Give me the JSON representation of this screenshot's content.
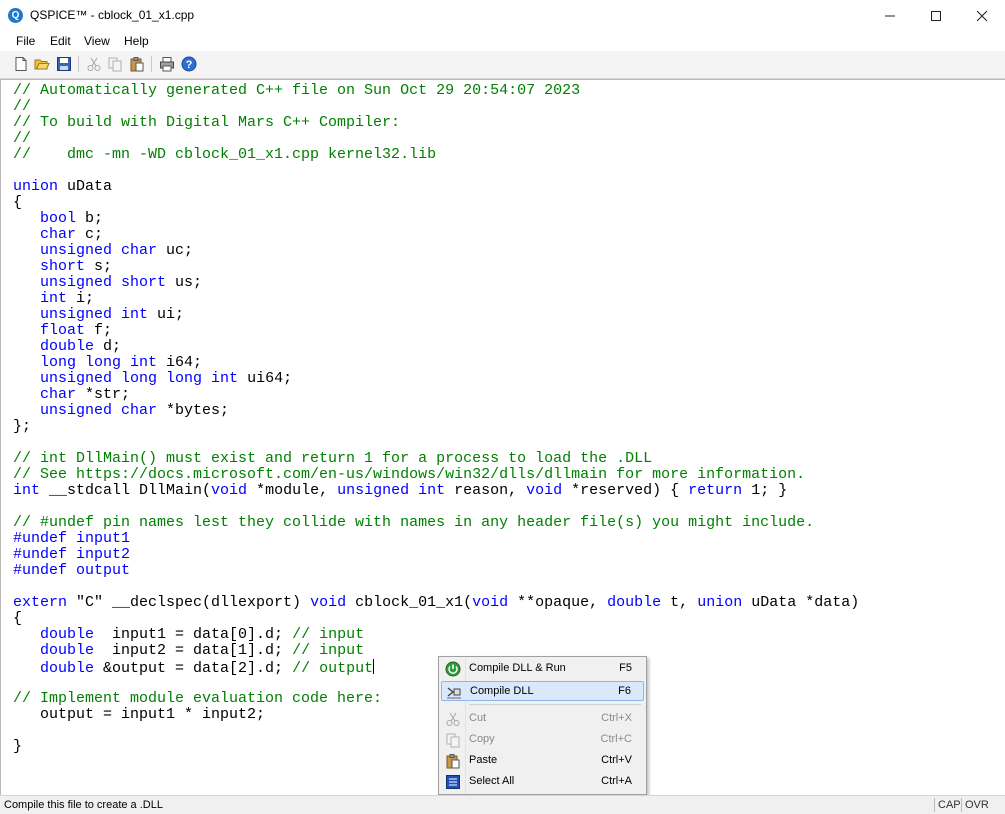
{
  "window": {
    "title": "QSPICE™ - cblock_01_x1.cpp",
    "app_icon_glyph": "Q",
    "icons": [
      "qspice-app-icon",
      "minimize-icon",
      "maximize-icon",
      "close-icon"
    ]
  },
  "menubar": {
    "items": [
      "File",
      "Edit",
      "View",
      "Help"
    ]
  },
  "toolbar": {
    "buttons": [
      {
        "name": "new-file-icon",
        "enabled": true
      },
      {
        "name": "open-folder-icon",
        "enabled": true
      },
      {
        "name": "save-icon",
        "enabled": true
      },
      {
        "name": "cut-icon",
        "enabled": false
      },
      {
        "name": "copy-icon",
        "enabled": false
      },
      {
        "name": "paste-icon",
        "enabled": true
      },
      {
        "name": "print-icon",
        "enabled": true
      },
      {
        "name": "help-icon",
        "enabled": true
      }
    ]
  },
  "editor": {
    "colors": {
      "comment": "#008000",
      "keyword": "#0000ff",
      "text": "#000000"
    },
    "lines": [
      [
        {
          "t": "// Automatically generated C++ file on Sun Oct 29 20:54:07 2023",
          "c": "cm"
        }
      ],
      [
        {
          "t": "//",
          "c": "cm"
        }
      ],
      [
        {
          "t": "// To build with Digital Mars C++ Compiler:",
          "c": "cm"
        }
      ],
      [
        {
          "t": "//",
          "c": "cm"
        }
      ],
      [
        {
          "t": "//    dmc -mn -WD cblock_01_x1.cpp kernel32.lib",
          "c": "cm"
        }
      ],
      [],
      [
        {
          "t": "union",
          "c": "kw"
        },
        {
          "t": " uData"
        }
      ],
      [
        {
          "t": "{"
        }
      ],
      [
        {
          "t": "   "
        },
        {
          "t": "bool",
          "c": "kw"
        },
        {
          "t": " b;"
        }
      ],
      [
        {
          "t": "   "
        },
        {
          "t": "char",
          "c": "kw"
        },
        {
          "t": " c;"
        }
      ],
      [
        {
          "t": "   "
        },
        {
          "t": "unsigned char",
          "c": "kw"
        },
        {
          "t": " uc;"
        }
      ],
      [
        {
          "t": "   "
        },
        {
          "t": "short",
          "c": "kw"
        },
        {
          "t": " s;"
        }
      ],
      [
        {
          "t": "   "
        },
        {
          "t": "unsigned short",
          "c": "kw"
        },
        {
          "t": " us;"
        }
      ],
      [
        {
          "t": "   "
        },
        {
          "t": "int",
          "c": "kw"
        },
        {
          "t": " i;"
        }
      ],
      [
        {
          "t": "   "
        },
        {
          "t": "unsigned int",
          "c": "kw"
        },
        {
          "t": " ui;"
        }
      ],
      [
        {
          "t": "   "
        },
        {
          "t": "float",
          "c": "kw"
        },
        {
          "t": " f;"
        }
      ],
      [
        {
          "t": "   "
        },
        {
          "t": "double",
          "c": "kw"
        },
        {
          "t": " d;"
        }
      ],
      [
        {
          "t": "   "
        },
        {
          "t": "long long int",
          "c": "kw"
        },
        {
          "t": " i64;"
        }
      ],
      [
        {
          "t": "   "
        },
        {
          "t": "unsigned long long int",
          "c": "kw"
        },
        {
          "t": " ui64;"
        }
      ],
      [
        {
          "t": "   "
        },
        {
          "t": "char",
          "c": "kw"
        },
        {
          "t": " *str;"
        }
      ],
      [
        {
          "t": "   "
        },
        {
          "t": "unsigned char",
          "c": "kw"
        },
        {
          "t": " *bytes;"
        }
      ],
      [
        {
          "t": "};"
        }
      ],
      [],
      [
        {
          "t": "// int DllMain() must exist and return 1 for a process to load the .DLL",
          "c": "cm"
        }
      ],
      [
        {
          "t": "// See https://docs.microsoft.com/en-us/windows/win32/dlls/dllmain for more information.",
          "c": "cm"
        }
      ],
      [
        {
          "t": "int",
          "c": "kw"
        },
        {
          "t": " __stdcall DllMain("
        },
        {
          "t": "void",
          "c": "kw"
        },
        {
          "t": " *module, "
        },
        {
          "t": "unsigned int",
          "c": "kw"
        },
        {
          "t": " reason, "
        },
        {
          "t": "void",
          "c": "kw"
        },
        {
          "t": " *reserved) { "
        },
        {
          "t": "return",
          "c": "kw"
        },
        {
          "t": " 1; }"
        }
      ],
      [],
      [
        {
          "t": "// #undef pin names lest they collide with names in any header file(s) you might include.",
          "c": "cm"
        }
      ],
      [
        {
          "t": "#undef",
          "c": "kw"
        },
        {
          "t": " "
        },
        {
          "t": "input1",
          "c": "kw"
        }
      ],
      [
        {
          "t": "#undef",
          "c": "kw"
        },
        {
          "t": " "
        },
        {
          "t": "input2",
          "c": "kw"
        }
      ],
      [
        {
          "t": "#undef",
          "c": "kw"
        },
        {
          "t": " "
        },
        {
          "t": "output",
          "c": "kw"
        }
      ],
      [],
      [
        {
          "t": "extern",
          "c": "kw"
        },
        {
          "t": " \"C\" __declspec(dllexport) "
        },
        {
          "t": "void",
          "c": "kw"
        },
        {
          "t": " cblock_01_x1("
        },
        {
          "t": "void",
          "c": "kw"
        },
        {
          "t": " **opaque, "
        },
        {
          "t": "double",
          "c": "kw"
        },
        {
          "t": " t, "
        },
        {
          "t": "union",
          "c": "kw"
        },
        {
          "t": " uData *data)"
        }
      ],
      [
        {
          "t": "{"
        }
      ],
      [
        {
          "t": "   "
        },
        {
          "t": "double",
          "c": "kw"
        },
        {
          "t": "  input1 = data[0].d; "
        },
        {
          "t": "// input",
          "c": "cm"
        }
      ],
      [
        {
          "t": "   "
        },
        {
          "t": "double",
          "c": "kw"
        },
        {
          "t": "  input2 = data[1].d; "
        },
        {
          "t": "// input",
          "c": "cm"
        }
      ],
      [
        {
          "t": "   "
        },
        {
          "t": "double",
          "c": "kw"
        },
        {
          "t": " &output = data[2].d; "
        },
        {
          "t": "// output",
          "c": "cm"
        },
        {
          "caret": true
        }
      ],
      [],
      [
        {
          "t": "// Implement module evaluation code here:",
          "c": "cm"
        }
      ],
      [
        {
          "t": "   output = input1 * input2;"
        }
      ],
      [],
      [
        {
          "t": "}"
        }
      ]
    ]
  },
  "context_menu": {
    "items": [
      {
        "label": "Compile DLL & Run",
        "shortcut": "F5",
        "icon": "compile-run-icon",
        "enabled": true,
        "highlighted": false
      },
      {
        "label": "Compile DLL",
        "shortcut": "F6",
        "icon": "compile-dll-icon",
        "enabled": true,
        "highlighted": true
      },
      {
        "separator": true
      },
      {
        "label": "Cut",
        "shortcut": "Ctrl+X",
        "icon": "cut-icon",
        "enabled": false,
        "highlighted": false
      },
      {
        "label": "Copy",
        "shortcut": "Ctrl+C",
        "icon": "copy-icon",
        "enabled": false,
        "highlighted": false
      },
      {
        "label": "Paste",
        "shortcut": "Ctrl+V",
        "icon": "paste-icon",
        "enabled": true,
        "highlighted": false
      },
      {
        "label": "Select All",
        "shortcut": "Ctrl+A",
        "icon": "select-all-icon",
        "enabled": true,
        "highlighted": false
      }
    ]
  },
  "statusbar": {
    "message": "Compile this file to create a .DLL",
    "indicators": [
      "CAP",
      "OVR"
    ]
  }
}
